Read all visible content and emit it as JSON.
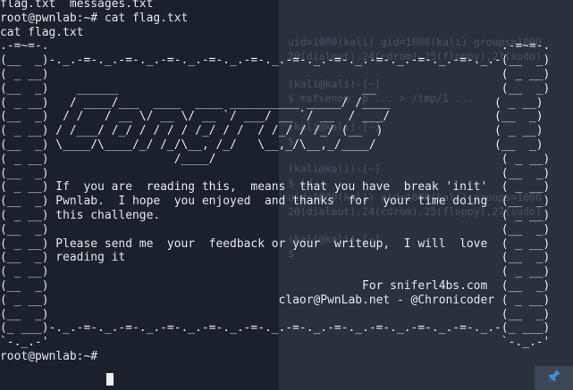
{
  "background_terminal": {
    "lines": [
      "uid=1000(kali) gid=1000(kali) groups=1000",
      "20(dialout),24(cdrom),25(floppy),27(sudo)",
      "",
      "(kali@kali)-[~]",
      "$ msfvenom -p ... > /tmp/1 ...",
      "",
      "(kali@kali)-[~]",
      "$",
      "",
      "(kali@kali)-[~]",
      "$ id",
      "uid=1000(kali) gid=1000(kali) groups=1000",
      "20(dialout),24(cdrom),25(floppy),27(sudo)",
      "",
      "(kali@kali)-[~]",
      "$"
    ]
  },
  "terminal": {
    "text": "flag.txt  messages.txt\nroot@pwnlab:~# cat flag.txt\ncat flag.txt\n.-=~=-.                                                                 .-=~=-.\n(__  _)-._.-=-._.-=-._.-=-._.-=-._.-=-._.-=-._.-=-._.-=-._.-=-._.-=-._.-(__  _)\n( _ __)                                                                 ( _ __)\n(__  _)    ______                                   __                  (__  _)\n( _ __)   / ____/___  ____  ____ __________ _____/ /____               ( _ __)\n(__  _)  / /   / __ \\/ __ \\/ __ `/ ___/ __ `/ __  / ___/               (__  _)\n( _ __) / /___/ /_/ / / / / /_/ / /  / /_/ / /_/ (__  )                ( _ __)\n(__  _) \\____/\\____/_/ /_/\\__, /_/   \\__,_/\\__,_/____/                 (__  _)\n( _ __)                  /____/                                         ( _ __)\n(__  _)                                                                 (__  _)\n( _ __) If  you are  reading this,  means  that you have  break 'init'  ( _ __)\n(__  _) Pwnlab.  I hope  you enjoyed  and thanks  for  your time doing  (__  _)\n( _ __) this challenge.                                                 ( _ __)\n(__  _)                                                                 (__  _)\n( _ __) Please send me  your  feedback or your  writeup,  I will  love  ( _ __)\n(__  _) reading it                                                      (__  _)\n( _ __)                                                                 ( _ __)\n(__  _)                                             For sniferl4bs.com  (__  _)\n( _ __)                                 claor@PwnLab.net - @Chronicoder ( _ __)\n(__  _)                                                                 (__  _)\n(_ ___)-._.-=-._.-=-._.-=-._.-=-._.-=-._.-=-._.-=-._.-=-._.-=-._.-=-._.-(_ ___)\n`-._.-'                                                                 `-._.-'\n",
    "prompt": "root@pwnlab:~# "
  },
  "colors": {
    "terminal_bg": "#1a212d",
    "text": "#e8e8e8",
    "accent_icon": "#3b8fd4"
  },
  "icons": {
    "corner_button": "pin-icon"
  }
}
